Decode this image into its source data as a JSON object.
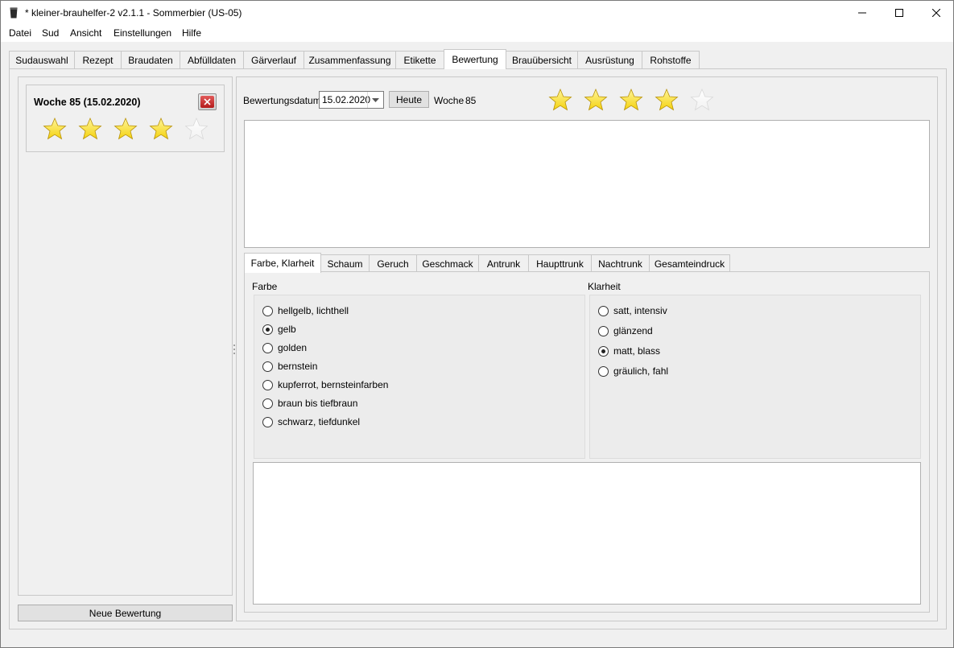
{
  "window": {
    "title": "* kleiner-brauhelfer-2 v2.1.1 - Sommerbier (US-05)"
  },
  "menu": [
    "Datei",
    "Sud",
    "Ansicht",
    "Einstellungen",
    "Hilfe"
  ],
  "tabs": [
    {
      "label": "Sudauswahl",
      "active": false
    },
    {
      "label": "Rezept",
      "active": false
    },
    {
      "label": "Braudaten",
      "active": false
    },
    {
      "label": "Abfülldaten",
      "active": false
    },
    {
      "label": "Gärverlauf",
      "active": false
    },
    {
      "label": "Zusammenfassung",
      "active": false
    },
    {
      "label": "Etikette",
      "active": false
    },
    {
      "label": "Bewertung",
      "active": true
    },
    {
      "label": "Brauübersicht",
      "active": false
    },
    {
      "label": "Ausrüstung",
      "active": false
    },
    {
      "label": "Rohstoffe",
      "active": false
    }
  ],
  "left": {
    "entries": [
      {
        "title": "Woche 85 (15.02.2020)",
        "stars": 4,
        "max_stars": 5
      }
    ],
    "new_button": "Neue Bewertung"
  },
  "right": {
    "date_label": "Bewertungsdatum",
    "date_value": "15.02.2020",
    "today_button": "Heute",
    "week_label": "Woche",
    "week_value": "85",
    "stars": 4,
    "max_stars": 5,
    "comment_text": ""
  },
  "subtabs": [
    {
      "label": "Farbe, Klarheit",
      "active": true
    },
    {
      "label": "Schaum",
      "active": false
    },
    {
      "label": "Geruch",
      "active": false
    },
    {
      "label": "Geschmack",
      "active": false
    },
    {
      "label": "Antrunk",
      "active": false
    },
    {
      "label": "Haupttrunk",
      "active": false
    },
    {
      "label": "Nachtrunk",
      "active": false
    },
    {
      "label": "Gesamteindruck",
      "active": false
    }
  ],
  "farbe": {
    "label": "Farbe",
    "options": [
      {
        "label": "hellgelb, lichthell",
        "checked": false
      },
      {
        "label": "gelb",
        "checked": true
      },
      {
        "label": "golden",
        "checked": false
      },
      {
        "label": "bernstein",
        "checked": false
      },
      {
        "label": "kupferrot, bernsteinfarben",
        "checked": false
      },
      {
        "label": "braun bis tiefbraun",
        "checked": false
      },
      {
        "label": "schwarz, tiefdunkel",
        "checked": false
      }
    ]
  },
  "klarheit": {
    "label": "Klarheit",
    "options": [
      {
        "label": "satt, intensiv",
        "checked": false
      },
      {
        "label": "glänzend",
        "checked": false
      },
      {
        "label": "matt, blass",
        "checked": true
      },
      {
        "label": "gräulich, fahl",
        "checked": false
      }
    ]
  },
  "notes_text": "",
  "colors": {
    "star_filled": "#f4d20e",
    "star_empty": "#f2f2f2",
    "delete_red": "#c62828"
  },
  "icons": {
    "app": "beer-glass-icon",
    "star": "star-icon",
    "delete": "delete-x-icon",
    "dropdown": "chevron-down-icon"
  }
}
